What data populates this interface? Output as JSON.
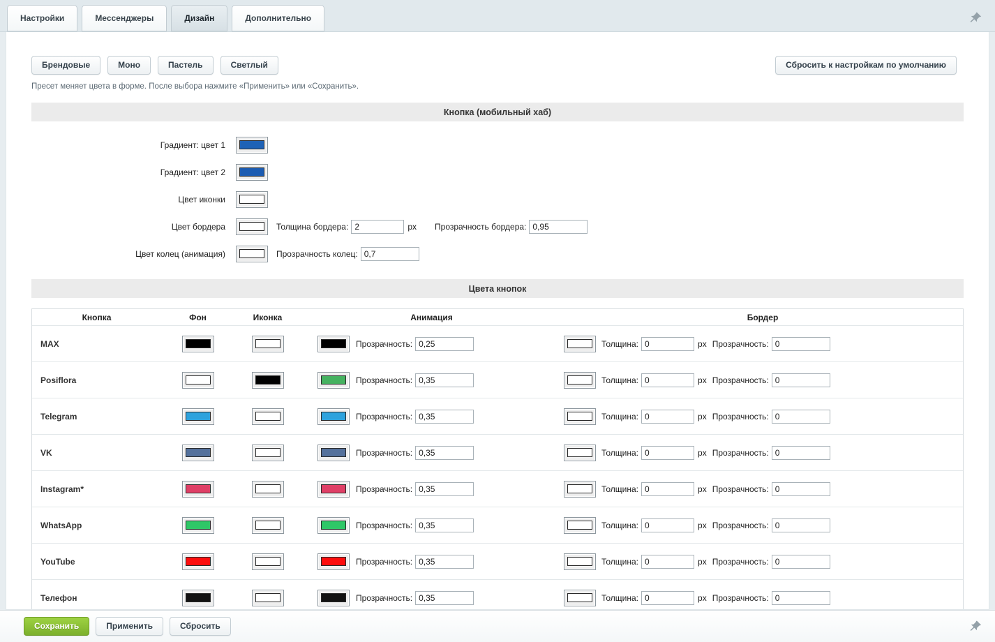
{
  "tabs": {
    "settings": "Настройки",
    "messengers": "Мессенджеры",
    "design": "Дизайн",
    "additional": "Дополнительно"
  },
  "presets": {
    "brand": "Брендовые",
    "mono": "Моно",
    "pastel": "Пастель",
    "light": "Светлый",
    "reset_default": "Сбросить к настройкам по умолчанию",
    "hint": "Пресет меняет цвета в форме. После выбора нажмите «Применить» или «Сохранить»."
  },
  "hub_section": {
    "title": "Кнопка (мобильный хаб)",
    "gradient1_label": "Градиент: цвет 1",
    "gradient1_color": "#1e62b6",
    "gradient2_label": "Градиент: цвет 2",
    "gradient2_color": "#1c5cb2",
    "icon_label": "Цвет иконки",
    "icon_color": "#ffffff",
    "border_label": "Цвет бордера",
    "border_color": "#ffffff",
    "border_thickness_label": "Толщина бордера:",
    "border_thickness_value": "2",
    "px": "px",
    "border_opacity_label": "Прозрачность бордера:",
    "border_opacity_value": "0,95",
    "rings_label": "Цвет колец (анимация)",
    "rings_color": "#ffffff",
    "rings_opacity_label": "Прозрачность колец:",
    "rings_opacity_value": "0,7"
  },
  "buttons_section": {
    "title": "Цвета кнопок",
    "col_button": "Кнопка",
    "col_bg": "Фон",
    "col_icon": "Иконка",
    "col_anim": "Анимация",
    "col_border": "Бордер",
    "opacity_label": "Прозрачность:",
    "thickness_label": "Толщина:",
    "px": "px",
    "rows": [
      {
        "name": "MAX",
        "bg": "#000000",
        "icon": "#ffffff",
        "anim": "#000000",
        "anim_opacity": "0,25",
        "border": "#ffffff",
        "thickness": "0",
        "border_opacity": "0"
      },
      {
        "name": "Posiflora",
        "bg": "#ffffff",
        "icon": "#000000",
        "anim": "#45b260",
        "anim_opacity": "0,35",
        "border": "#ffffff",
        "thickness": "0",
        "border_opacity": "0"
      },
      {
        "name": "Telegram",
        "bg": "#2da2dd",
        "icon": "#ffffff",
        "anim": "#2da2dd",
        "anim_opacity": "0,35",
        "border": "#ffffff",
        "thickness": "0",
        "border_opacity": "0"
      },
      {
        "name": "VK",
        "bg": "#54719c",
        "icon": "#ffffff",
        "anim": "#54719c",
        "anim_opacity": "0,35",
        "border": "#ffffff",
        "thickness": "0",
        "border_opacity": "0"
      },
      {
        "name": "Instagram*",
        "bg": "#df3f66",
        "icon": "#ffffff",
        "anim": "#df3f66",
        "anim_opacity": "0,35",
        "border": "#ffffff",
        "thickness": "0",
        "border_opacity": "0"
      },
      {
        "name": "WhatsApp",
        "bg": "#2fc767",
        "icon": "#ffffff",
        "anim": "#2fc767",
        "anim_opacity": "0,35",
        "border": "#ffffff",
        "thickness": "0",
        "border_opacity": "0"
      },
      {
        "name": "YouTube",
        "bg": "#fc0d0d",
        "icon": "#ffffff",
        "anim": "#fc0d0d",
        "anim_opacity": "0,35",
        "border": "#ffffff",
        "thickness": "0",
        "border_opacity": "0"
      },
      {
        "name": "Телефон",
        "bg": "#121212",
        "icon": "#ffffff",
        "anim": "#121212",
        "anim_opacity": "0,35",
        "border": "#ffffff",
        "thickness": "0",
        "border_opacity": "0"
      }
    ]
  },
  "footer": {
    "save": "Сохранить",
    "apply": "Применить",
    "reset": "Сбросить"
  }
}
